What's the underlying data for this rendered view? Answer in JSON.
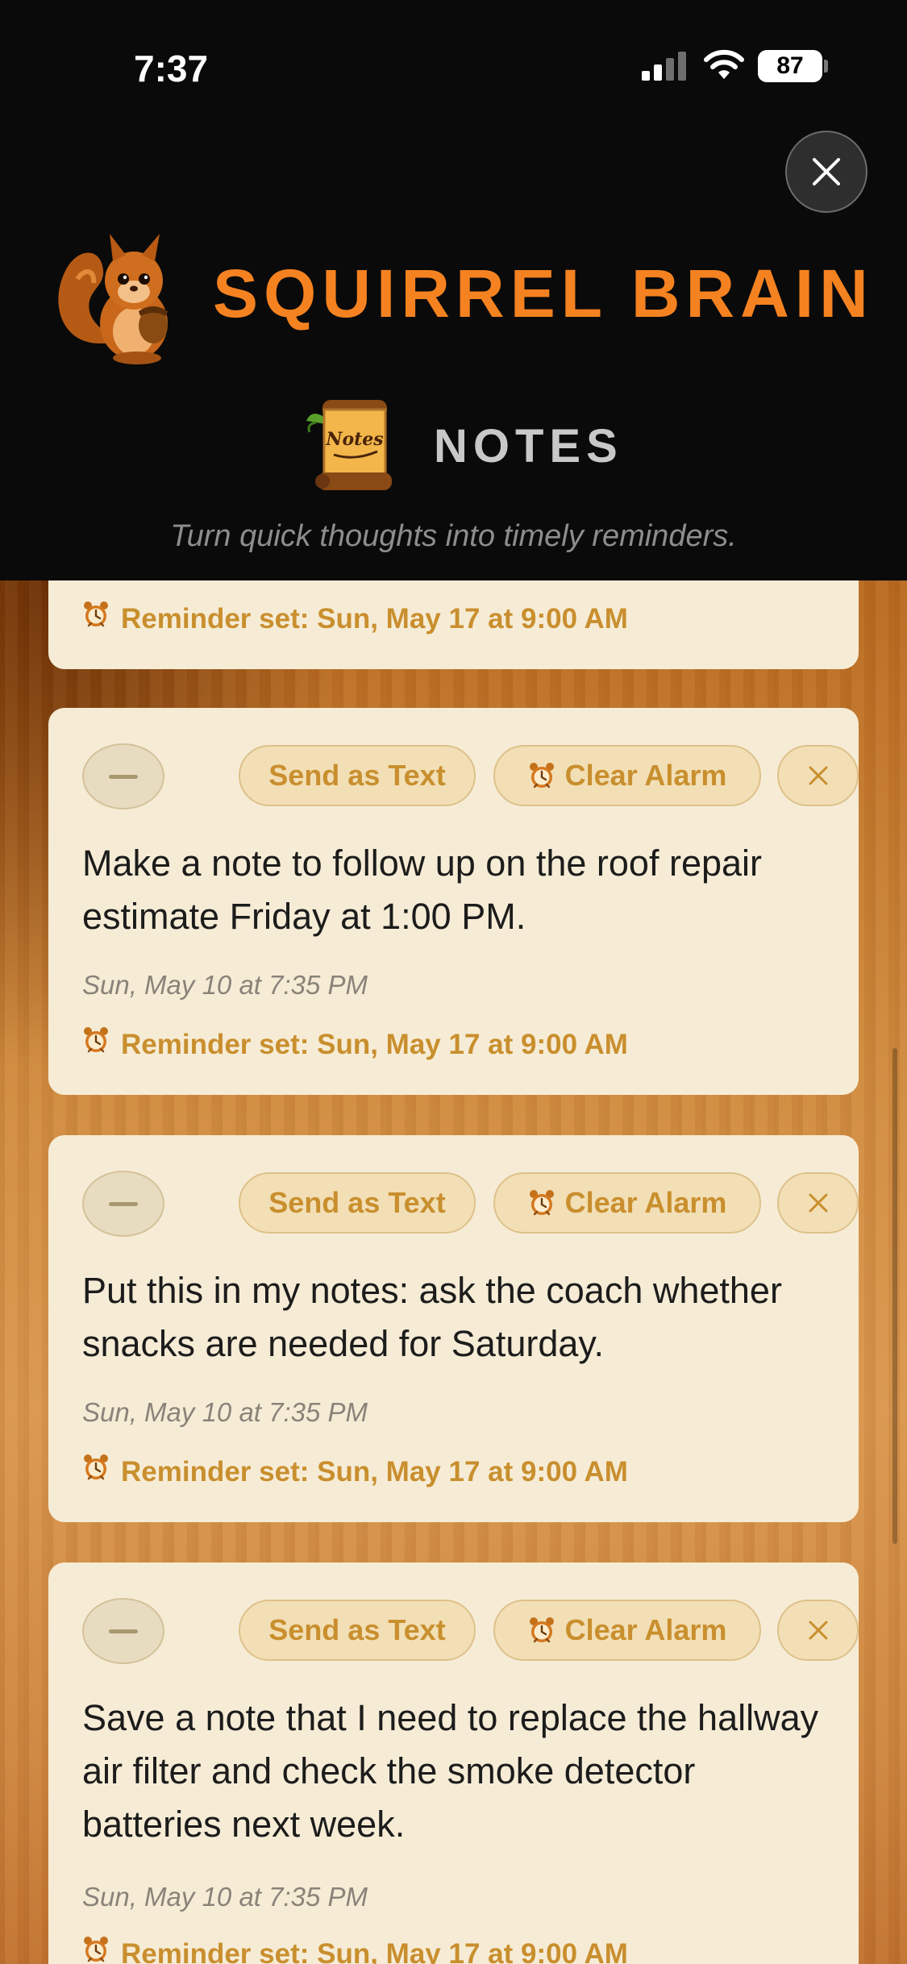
{
  "status_bar": {
    "time": "7:37",
    "battery": "87"
  },
  "app": {
    "brand_title": "SQUIRREL BRAIN",
    "section_title": "NOTES",
    "notes_icon_text": "Notes",
    "subtitle": "Turn quick thoughts into timely reminders.",
    "accent_color": "#f58220"
  },
  "notes": {
    "partial_top": {
      "reminder": "Reminder set: Sun, May 17 at 9:00 AM"
    },
    "items": [
      {
        "send_label": "Send as Text",
        "alarm_label": "Clear Alarm",
        "text": "Make a note to follow up on the roof repair estimate Friday at 1:00 PM.",
        "date": "Sun, May 10 at 7:35 PM",
        "reminder": "Reminder set: Sun, May 17 at 9:00 AM"
      },
      {
        "send_label": "Send as Text",
        "alarm_label": "Clear Alarm",
        "text": "Put this in my notes: ask the coach whether snacks are needed for Saturday.",
        "date": "Sun, May 10 at 7:35 PM",
        "reminder": "Reminder set: Sun, May 17 at 9:00 AM"
      },
      {
        "send_label": "Send as Text",
        "alarm_label": "Clear Alarm",
        "text": "Save a note that I need to replace the hallway air filter and check the smoke detector batteries next week.",
        "date": "Sun, May 10 at 7:35 PM",
        "reminder": "Reminder set: Sun, May 17 at 9:00 AM"
      }
    ]
  }
}
